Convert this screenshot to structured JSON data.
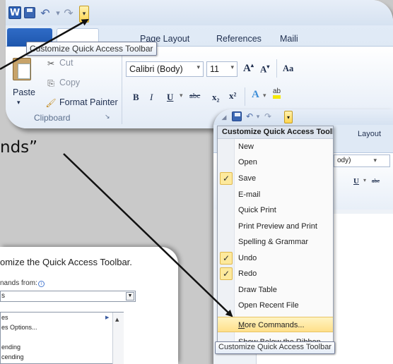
{
  "top_window": {
    "tabs": [
      "Page Layout",
      "References",
      "Maili"
    ],
    "clipboard": {
      "cut": "Cut",
      "copy": "Copy",
      "paste": "Paste",
      "format_painter": "Format Painter",
      "group_label": "Clipboard"
    },
    "font_name": "Calibri (Body)",
    "font_size": "11",
    "format_buttons": [
      "B",
      "I",
      "U",
      "abc",
      "x₂",
      "x²"
    ],
    "tooltip": "Customize Quick Access Toolbar"
  },
  "right_window": {
    "tab_label": "Layout",
    "font_fragment": "ody)"
  },
  "menu": {
    "title": "Customize Quick Access Toolbar",
    "items": [
      {
        "label": "New",
        "checked": false
      },
      {
        "label": "Open",
        "checked": false
      },
      {
        "label": "Save",
        "checked": true
      },
      {
        "label": "E-mail",
        "checked": false
      },
      {
        "label": "Quick Print",
        "checked": false
      },
      {
        "label": "Print Preview and Print",
        "checked": false
      },
      {
        "label": "Spelling & Grammar",
        "checked": false
      },
      {
        "label": "Undo",
        "checked": true
      },
      {
        "label": "Redo",
        "checked": true
      },
      {
        "label": "Draw Table",
        "checked": false
      },
      {
        "label": "Open Recent File",
        "checked": false
      }
    ],
    "highlighted": {
      "accel": "M",
      "rest": "ore Commands..."
    },
    "partial_item": "Show Below the Ribbon",
    "tooltip": "Customize Quick Access Toolbar"
  },
  "callout_text": "nds”",
  "dialog": {
    "title": "omize the Quick Access Toolbar.",
    "choose_label": "nands from:",
    "select_value": "s",
    "list_items": [
      "es",
      "es Options...",
      "",
      "ending",
      "cending"
    ]
  }
}
